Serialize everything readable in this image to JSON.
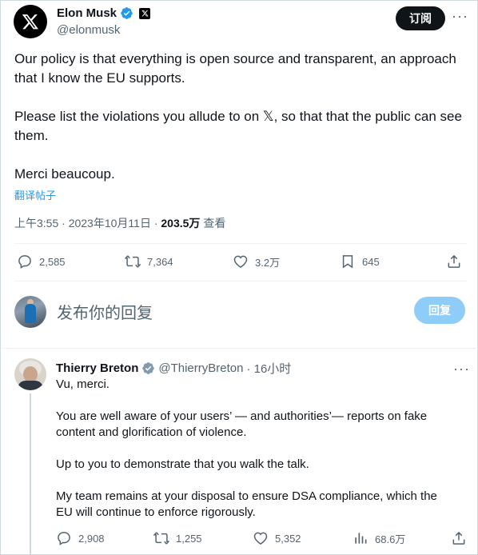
{
  "main_tweet": {
    "author_name": "Elon Musk",
    "handle": "@elonmusk",
    "subscribe_label": "订阅",
    "more_label": "···",
    "paragraphs": [
      "Our policy is that everything is open source and transparent, an approach that I know the EU supports.",
      "Please list the violations you allude to on 𝕏, so that that the public can see them.",
      "Merci beaucoup."
    ],
    "translate_label": "翻译帖子",
    "timestamp": "上午3:55 · 2023年10月11日 · ",
    "views_count": "203.5万",
    "views_label": " 查看",
    "replies": "2,585",
    "reposts": "7,364",
    "likes": "3.2万",
    "bookmarks": "645"
  },
  "reply_box": {
    "placeholder": "发布你的回复",
    "button_label": "回复"
  },
  "reply_tweet": {
    "author_name": "Thierry Breton",
    "handle": "@ThierryBreton",
    "time": "· 16小时",
    "more_label": "···",
    "paragraphs": [
      "Vu, merci.",
      "You are well aware of your users’ — and authorities’— reports on fake content and glorification of violence.",
      "Up to you to demonstrate that you walk the talk.",
      "My team remains at your disposal to ensure DSA compliance, which the EU will continue to enforce rigorously."
    ],
    "replies": "2,908",
    "reposts": "1,255",
    "likes": "5,352",
    "views": "68.6万"
  },
  "colors": {
    "text_primary": "#0f1419",
    "text_secondary": "#536471",
    "accent_blue": "#1d9bf0",
    "reply_button_disabled": "#8ecdf8",
    "gov_badge_gray": "#829aab"
  },
  "icons": [
    "x-logo-icon",
    "verified-badge-icon",
    "x-affiliate-badge-icon",
    "more-icon",
    "reply-icon",
    "repost-icon",
    "like-icon",
    "bookmark-icon",
    "share-icon",
    "views-icon",
    "government-badge-icon"
  ]
}
